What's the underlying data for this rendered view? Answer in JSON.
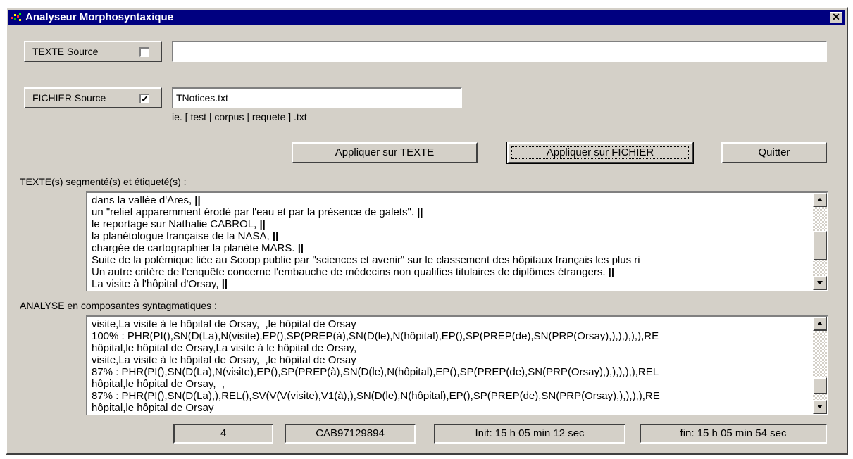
{
  "window": {
    "title": "Analyseur Morphosyntaxique",
    "close_glyph": "✕"
  },
  "texte_source": {
    "label": "TEXTE Source",
    "checked": false,
    "value": ""
  },
  "fichier_source": {
    "label": "FICHIER Source",
    "checked": true,
    "check_glyph": "✓",
    "value": "TNotices.txt",
    "hint": "ie. [ test | corpus | requete ] .txt"
  },
  "buttons": {
    "appliquer_texte": "Appliquer sur TEXTE",
    "appliquer_fichier": "Appliquer sur FICHIER",
    "quitter": "Quitter"
  },
  "segmented": {
    "label": "TEXTE(s) segmenté(s) et étiqueté(s) :",
    "lines": [
      "dans la vallée d'Ares,",
      "un \"relief apparemment érodé par l'eau et par la présence de galets\".",
      "le reportage sur Nathalie CABROL,",
      "la planétologue française de la NASA,",
      "chargée de cartographier la planète MARS.",
      "Suite de la polémique liée au Scoop publie par \"sciences et avenir\" sur le classement des hôpitaux français les plus ri",
      "Un autre critère de l'enquête concerne l'embauche de médecins non qualifies titulaires de diplômes étrangers.",
      "La visite à l'hôpital d'Orsay,"
    ],
    "end_marker": "||"
  },
  "analyse": {
    "label": "ANALYSE en composantes syntagmatiques :",
    "lines": [
      "visite,La visite à le hôpital de Orsay,_,le hôpital de Orsay",
      "100% : PHR(PI(),SN(D(La),N(visite),EP(),SP(PREP(à),SN(D(le),N(hôpital),EP(),SP(PREP(de),SN(PRP(Orsay),),),),),),RE",
      "hôpital,le hôpital de Orsay,La visite à le hôpital de Orsay,_",
      "visite,La visite à le hôpital de Orsay,_,le hôpital de Orsay",
      "87% : PHR(PI(),SN(D(La),N(visite),EP(),SP(PREP(à),SN(D(le),N(hôpital),EP(),SP(PREP(de),SN(PRP(Orsay),),),),),),REL",
      "hôpital,le hôpital de Orsay,_,_",
      "87% : PHR(PI(),SN(D(La),),REL(),SV(V(V(visite),V1(à),),SN(D(le),N(hôpital),EP(),SP(PREP(de),SN(PRP(Orsay),),),),),RE",
      "hôpital,le hôpital de Orsay"
    ]
  },
  "status": {
    "count": "4",
    "code": "CAB97129894",
    "init": "Init: 15 h 05 min 12 sec",
    "fin": "fin: 15 h 05 min 54 sec"
  },
  "colors": {
    "titlebar": "#000080",
    "face": "#d4d0c8"
  }
}
